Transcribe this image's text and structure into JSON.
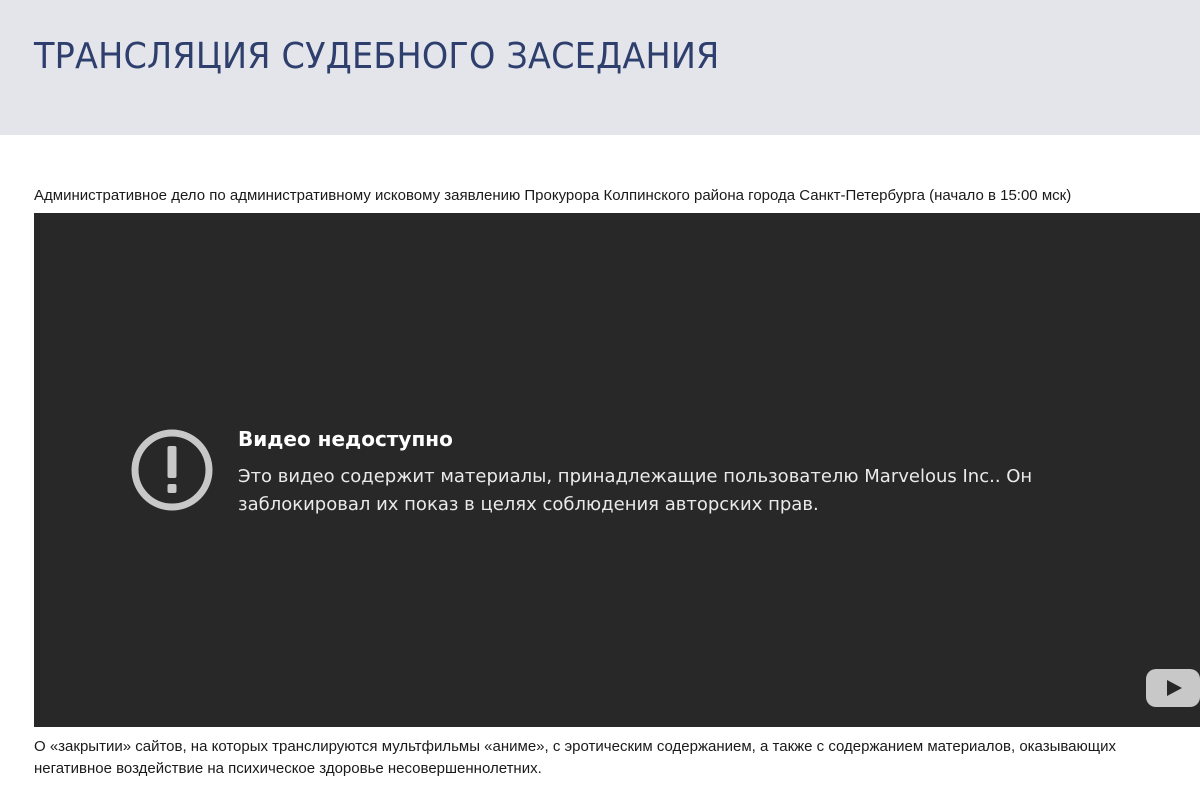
{
  "header": {
    "title": "ТРАНСЛЯЦИЯ СУДЕБНОГО ЗАСЕДАНИЯ"
  },
  "case": {
    "caption": "Административное дело по административному исковому заявлению Прокурора Колпинского района города Санкт-Петербурга (начало в 15:00 мск)"
  },
  "video": {
    "error_title": "Видео недоступно",
    "error_message": "Это видео содержит материалы, принадлежащие пользователю Marvelous Inc.. Он заблокировал их показ в целях соблюдения авторских прав.",
    "error_icon": "exclamation-circle-icon",
    "logo_icon": "youtube-logo-icon"
  },
  "footer": {
    "text": "О «закрытии» сайтов, на которых транслируются мультфильмы «аниме», с эротическим содержанием, а также с содержанием материалов, оказывающих негативное воздействие на психическое здоровье несовершеннолетних."
  },
  "colors": {
    "header_background": "#e4e5ea",
    "title_color": "#2e3f6e",
    "player_background": "#282828",
    "icon_color": "#c8c8c8"
  }
}
